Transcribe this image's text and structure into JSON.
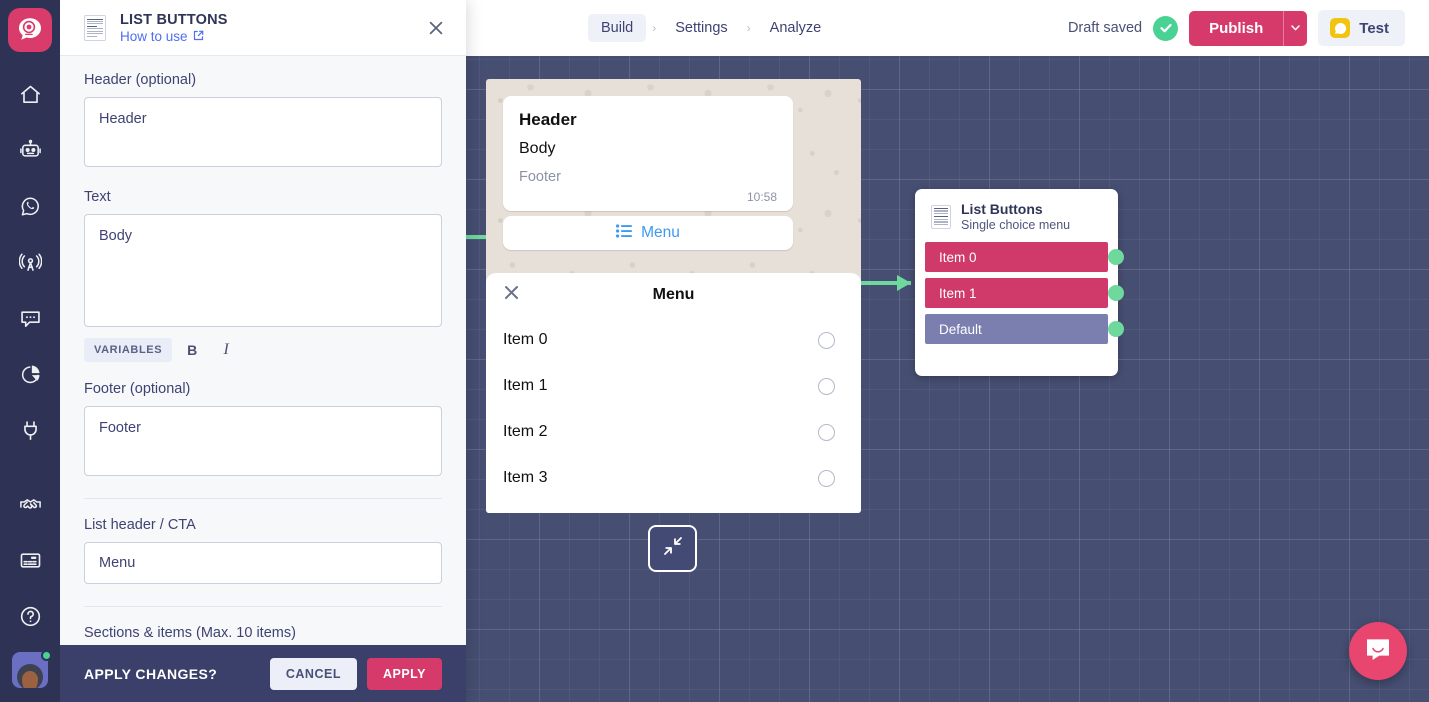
{
  "app": {
    "logo_icon": "chatbot-logo-icon"
  },
  "sidebar": {
    "items": [
      {
        "name": "home",
        "icon": "home-icon"
      },
      {
        "name": "bots",
        "icon": "robot-icon"
      },
      {
        "name": "whatsapp",
        "icon": "whatsapp-icon"
      },
      {
        "name": "broadcast",
        "icon": "broadcast-antenna-icon"
      },
      {
        "name": "chats",
        "icon": "chat-bubble-icon"
      },
      {
        "name": "analytics",
        "icon": "pie-chart-icon"
      },
      {
        "name": "integrations",
        "icon": "plug-icon"
      },
      {
        "name": "partners",
        "icon": "handshake-icon"
      },
      {
        "name": "billing",
        "icon": "credit-card-icon"
      },
      {
        "name": "help",
        "icon": "question-circle-icon"
      }
    ],
    "avatar": {
      "name": "user-avatar",
      "status": "online"
    }
  },
  "header": {
    "breadcrumbs": [
      {
        "label": "Build",
        "active": true
      },
      {
        "label": "Settings",
        "active": false
      },
      {
        "label": "Analyze",
        "active": false
      }
    ],
    "separator": "›",
    "draft_status": "Draft saved",
    "publish_label": "Publish",
    "publish_caret": "⌄",
    "test_label": "Test"
  },
  "panel": {
    "title": "LIST BUTTONS",
    "how_to_use": "How to use",
    "close_icon": "close-icon",
    "fields": {
      "header_label": "Header (optional)",
      "header_value": "Header",
      "text_label": "Text",
      "text_value": "Body",
      "footer_label": "Footer (optional)",
      "footer_value": "Footer",
      "list_header_label": "List header / CTA",
      "list_header_value": "Menu",
      "sections_label": "Sections & items (Max. 10 items)"
    },
    "toolbar": {
      "variables": "VARIABLES",
      "bold": "B",
      "italic": "I"
    },
    "footer": {
      "prompt": "APPLY CHANGES?",
      "cancel": "CANCEL",
      "apply": "APPLY"
    }
  },
  "preview": {
    "bubble": {
      "header": "Header",
      "body": "Body",
      "footer": "Footer",
      "time": "10:58"
    },
    "menu_cta": "Menu",
    "sheet": {
      "title": "Menu",
      "close_icon": "close-icon",
      "items": [
        "Item 0",
        "Item 1",
        "Item 2",
        "Item 3"
      ]
    },
    "collapse_icon": "collapse-arrows-icon"
  },
  "node": {
    "title": "List Buttons",
    "subtitle": "Single choice menu",
    "rows": [
      {
        "label": "Item 0",
        "color": "#cf3a6b"
      },
      {
        "label": "Item 1",
        "color": "#cf3a6b"
      },
      {
        "label": "Default",
        "color": "#7b7fb0"
      }
    ]
  },
  "intercom": {
    "icon": "intercom-chat-icon"
  },
  "colors": {
    "brand_pink": "#d63a6a",
    "canvas": "#464e72",
    "sidebar": "#2e3356",
    "connector_green": "#6ed89d",
    "link_blue": "#4f6ef0"
  }
}
